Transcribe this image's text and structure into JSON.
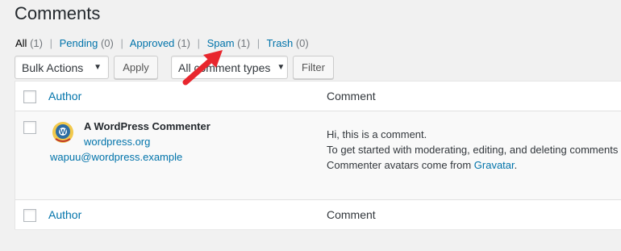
{
  "page": {
    "title": "Comments"
  },
  "filters": {
    "all": {
      "label": "All",
      "count": "(1)"
    },
    "pending": {
      "label": "Pending",
      "count": "(0)"
    },
    "approved": {
      "label": "Approved",
      "count": "(1)"
    },
    "spam": {
      "label": "Spam",
      "count": "(1)"
    },
    "trash": {
      "label": "Trash",
      "count": "(0)"
    },
    "separator": "|"
  },
  "toolbar": {
    "bulk_actions": "Bulk Actions",
    "apply": "Apply",
    "comment_types": "All comment types",
    "filter": "Filter"
  },
  "table": {
    "columns": {
      "author": "Author",
      "comment": "Comment"
    },
    "rows": [
      {
        "author_name": "A WordPress Commenter",
        "author_url": "wordpress.org",
        "author_email": "wapuu@wordpress.example",
        "comment_line1": "Hi, this is a comment.",
        "comment_line2": "To get started with moderating, editing, and deleting comments",
        "comment_line3_prefix": "Commenter avatars come from ",
        "comment_line3_link": "Gravatar",
        "comment_line3_suffix": "."
      }
    ]
  },
  "colors": {
    "link": "#0073aa",
    "annotation_arrow": "#e8262d",
    "background": "#f1f1f1"
  }
}
